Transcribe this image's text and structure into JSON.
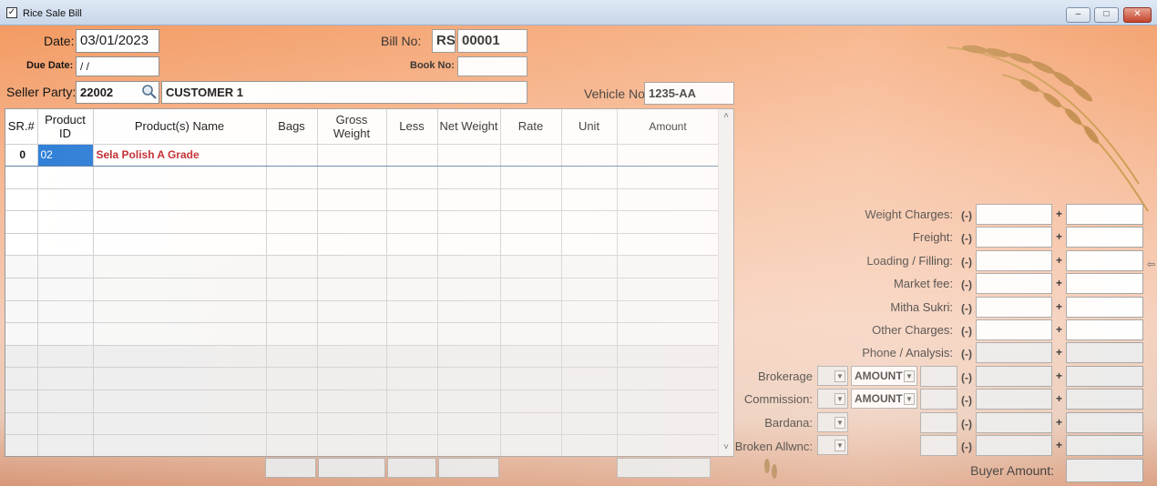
{
  "window": {
    "title": "Rice Sale Bill",
    "controls": {
      "minimize": "–",
      "maximize": "□",
      "close": "✕"
    }
  },
  "header": {
    "date_label": "Date:",
    "date_value": "03/01/2023",
    "due_date_label": "Due Date:",
    "due_date_value": "/ /",
    "seller_party_label": "Seller Party:",
    "seller_party_code": "22002",
    "seller_party_name": "CUSTOMER 1",
    "bill_no_label": "Bill No:",
    "bill_prefix": "RS",
    "bill_no_value": "00001",
    "book_no_label": "Book No:",
    "book_no_value": "",
    "vehicle_no_label": "Vehicle No:",
    "vehicle_no_value": "1235-AA"
  },
  "grid": {
    "columns": [
      "SR.#",
      "Product ID",
      "Product(s) Name",
      "Bags",
      "Gross Weight",
      "Less",
      "Net Weight",
      "Rate",
      "Unit",
      "Amount"
    ],
    "rows": [
      {
        "sr": "0",
        "product_id": "02",
        "product_name": "Sela Polish A Grade",
        "bags": "",
        "gross": "",
        "less": "",
        "net": "",
        "rate": "",
        "unit": "",
        "amount": ""
      }
    ],
    "empty_rows": 13
  },
  "charges": {
    "minus_sign": "(-)",
    "plus_sign": "+",
    "items": [
      {
        "label": "Weight Charges:"
      },
      {
        "label": "Freight:"
      },
      {
        "label": "Loading / Filling:"
      },
      {
        "label": "Market fee:"
      },
      {
        "label": "Mitha Sukri:"
      },
      {
        "label": "Other Charges:"
      },
      {
        "label": "Phone / Analysis:"
      }
    ],
    "brokerage_label": "Brokerage",
    "brokerage_type": "AMOUNT",
    "commission_label": "Commission:",
    "commission_type": "AMOUNT",
    "bardana_label": "Bardana:",
    "broken_label": "Broken Allwnc:",
    "buyer_amount_label": "Buyer Amount:"
  },
  "colors": {
    "accent_orange": "#f39a62",
    "product_name_red": "#c0262c",
    "selection_blue": "#2f7fd8"
  },
  "icons": [
    "checkbox-app-icon",
    "search-icon",
    "scroll-up-icon",
    "scroll-down-icon",
    "chevron-down-icon"
  ]
}
